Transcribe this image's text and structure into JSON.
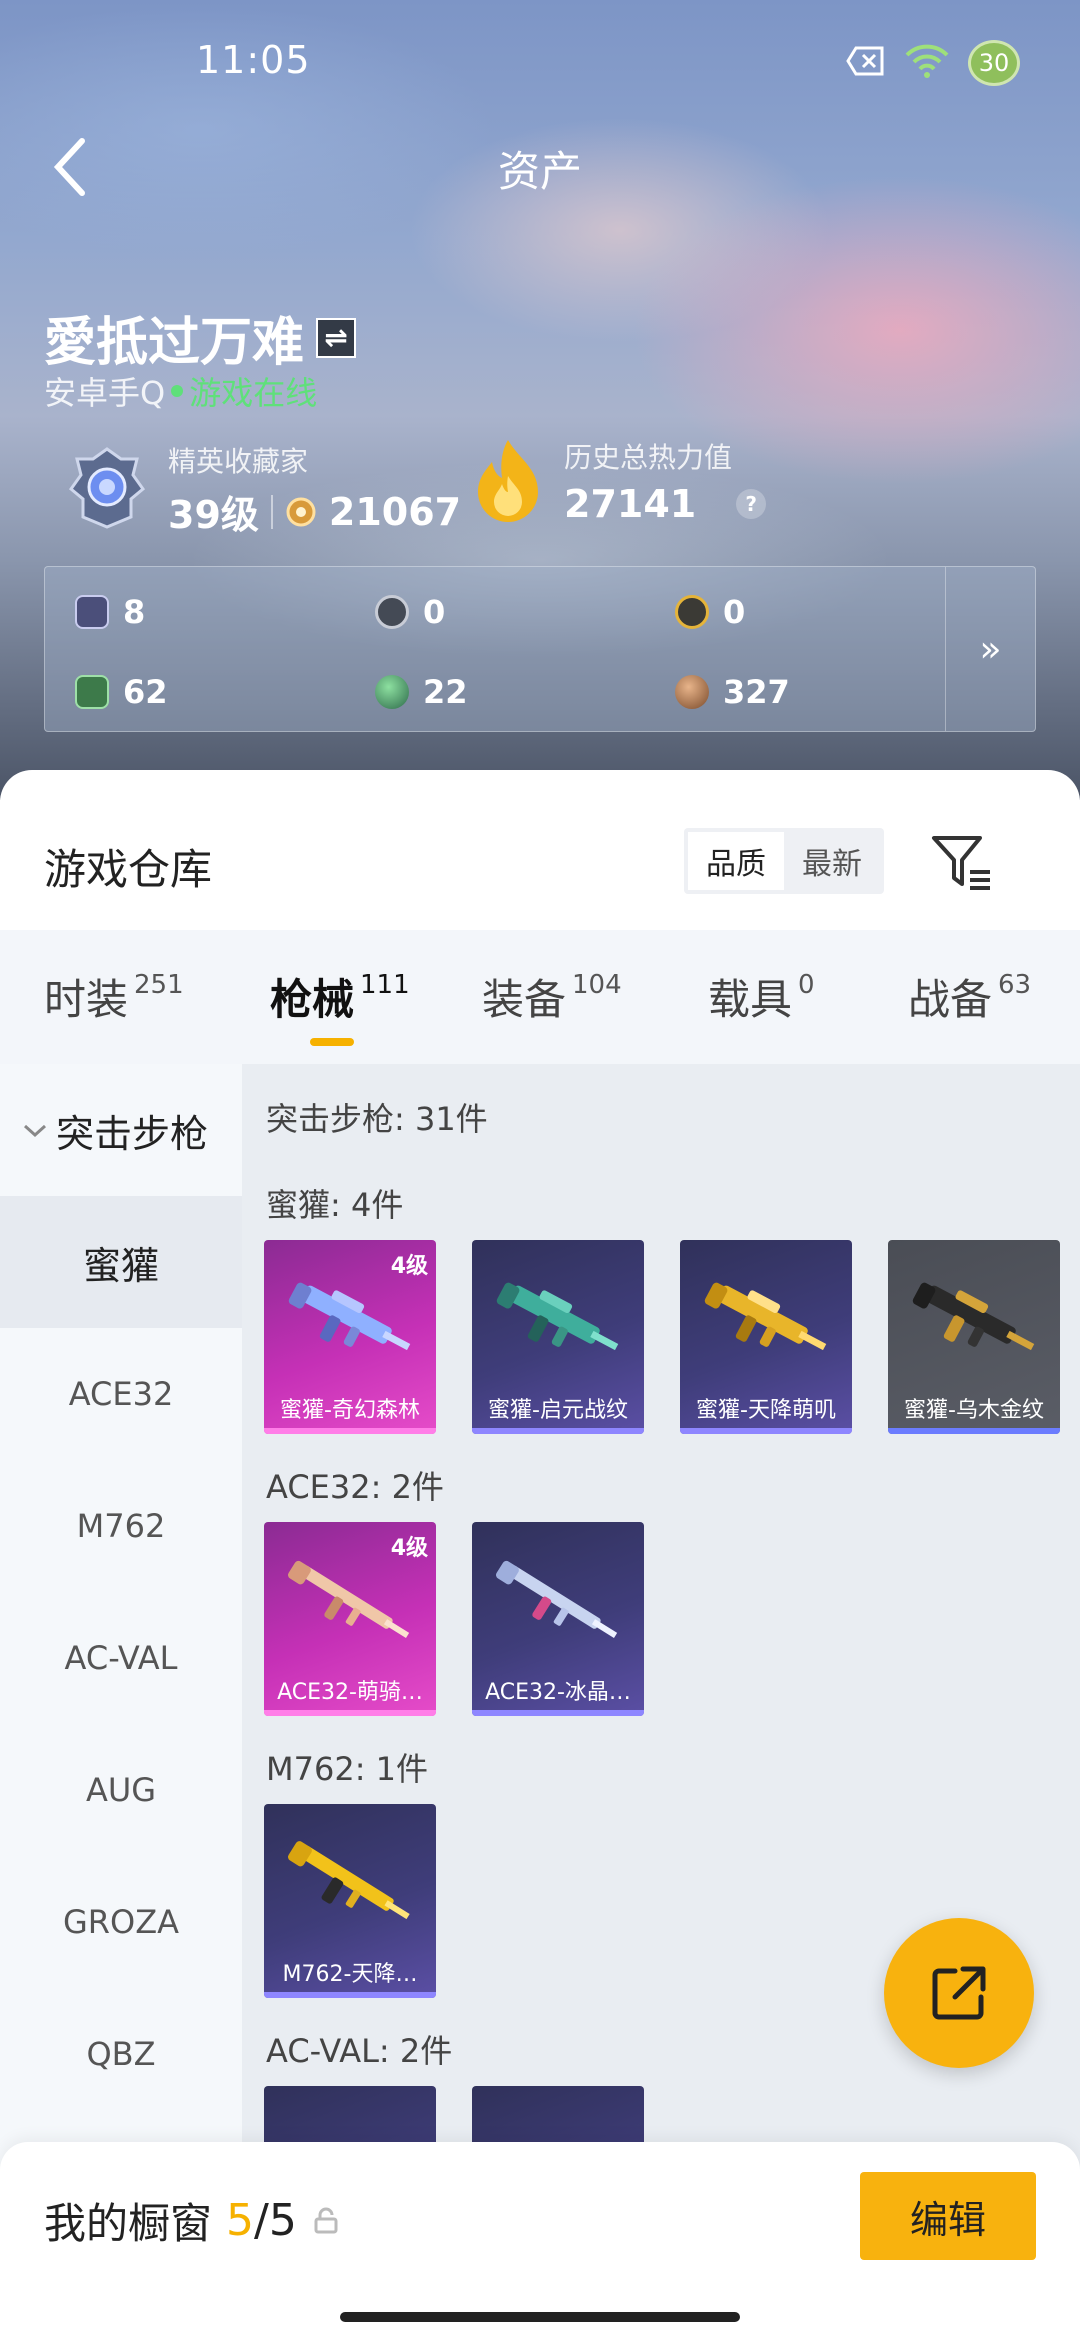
{
  "status_bar": {
    "time": "11:05",
    "battery": "30"
  },
  "header": {
    "title": "资产"
  },
  "profile": {
    "username": "愛抵过万难",
    "platform": "安卓手Q",
    "online_status": "游戏在线",
    "rank_title": "精英收藏家",
    "level": "39级",
    "collection_points": "21067",
    "heat_title": "历史总热力值",
    "heat_value": "27141",
    "help": "?"
  },
  "stats": [
    {
      "icon": "card-icon",
      "value": "8"
    },
    {
      "icon": "coin-silver-icon",
      "value": "0"
    },
    {
      "icon": "coin-gold-icon",
      "value": "0"
    },
    {
      "icon": "green-card-icon",
      "value": "62"
    },
    {
      "icon": "green-orb-icon",
      "value": "22"
    },
    {
      "icon": "bronze-orb-icon",
      "value": "327"
    }
  ],
  "warehouse": {
    "title": "游戏仓库",
    "sort_quality": "品质",
    "sort_latest": "最新"
  },
  "tabs": [
    {
      "label": "时装",
      "count": "251"
    },
    {
      "label": "枪械",
      "count": "111",
      "active": true
    },
    {
      "label": "装备",
      "count": "104"
    },
    {
      "label": "载具",
      "count": "0"
    },
    {
      "label": "战备",
      "count": "63"
    }
  ],
  "sidebar": {
    "category": "突击步枪",
    "items": [
      "蜜獾",
      "ACE32",
      "M762",
      "AC-VAL",
      "AUG",
      "GROZA",
      "QBZ"
    ]
  },
  "content": {
    "summary": "突击步枪: 31件",
    "groups": [
      {
        "title": "蜜獾: 4件",
        "items": [
          {
            "name": "蜜獾-奇幻森林",
            "level": "4级",
            "rarity": "pink"
          },
          {
            "name": "蜜獾-启元战纹",
            "rarity": "purple"
          },
          {
            "name": "蜜獾-天降萌叽",
            "rarity": "purple"
          },
          {
            "name": "蜜獾-乌木金纹",
            "rarity": "gray"
          }
        ]
      },
      {
        "title": "ACE32: 2件",
        "items": [
          {
            "name": "ACE32-萌骑…",
            "level": "4级",
            "rarity": "pink"
          },
          {
            "name": "ACE32-冰晶…",
            "rarity": "purple"
          }
        ]
      },
      {
        "title": "M762: 1件",
        "items": [
          {
            "name": "M762-天降…",
            "rarity": "purple"
          }
        ]
      },
      {
        "title": "AC-VAL: 2件",
        "items": []
      }
    ]
  },
  "showcase": {
    "label": "我的橱窗",
    "current": "5",
    "total": "/5",
    "edit": "编辑"
  },
  "colors": {
    "accent": "#f8b20e",
    "online": "#5fe07a",
    "pink": "#c530b6",
    "purple": "#3f3d7a"
  }
}
